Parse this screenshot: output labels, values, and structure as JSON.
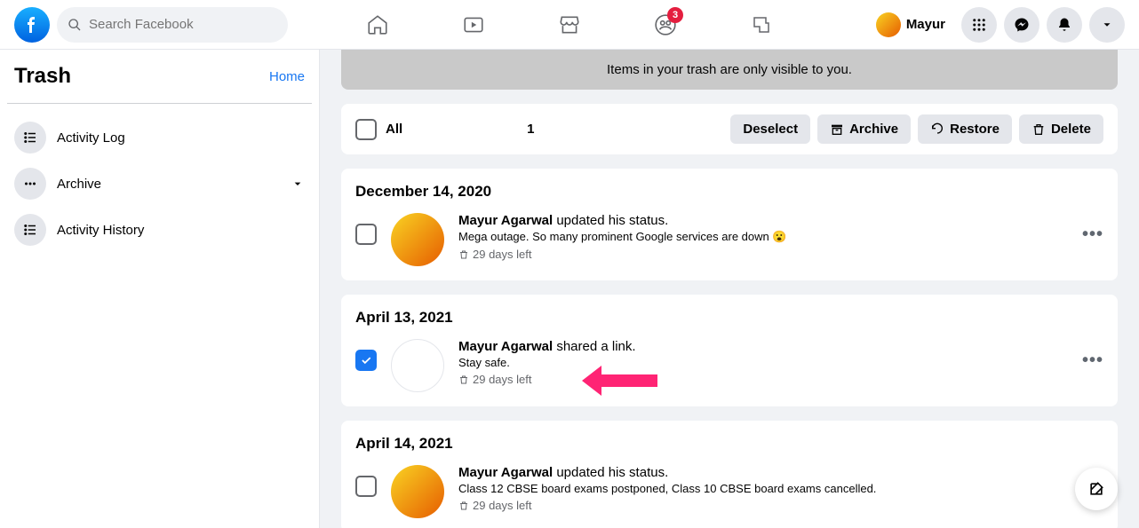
{
  "topnav": {
    "search_placeholder": "Search Facebook",
    "badge_count": "3",
    "profile_name": "Mayur"
  },
  "sidebar": {
    "title": "Trash",
    "home_link": "Home",
    "items": [
      {
        "label": "Activity Log"
      },
      {
        "label": "Archive"
      },
      {
        "label": "Activity History"
      }
    ]
  },
  "notice": "Items in your trash are only visible to you.",
  "actionbar": {
    "all_label": "All",
    "count": "1",
    "deselect": "Deselect",
    "archive": "Archive",
    "restore": "Restore",
    "delete": "Delete"
  },
  "cards": [
    {
      "date": "December 14, 2020",
      "checked": false,
      "avatar": "photo",
      "user": "Mayur Agarwal",
      "action": " updated his status.",
      "body": "Mega outage. So many prominent Google services are down 😮",
      "meta": "29 days left"
    },
    {
      "date": "April 13, 2021",
      "checked": true,
      "avatar": "blank",
      "user": "Mayur Agarwal",
      "action": " shared a link.",
      "body": "Stay safe.",
      "meta": "29 days left"
    },
    {
      "date": "April 14, 2021",
      "checked": false,
      "avatar": "photo",
      "user": "Mayur Agarwal",
      "action": " updated his status.",
      "body": "Class 12 CBSE board exams postponed, Class 10 CBSE board exams cancelled.",
      "meta": "29 days left"
    }
  ]
}
